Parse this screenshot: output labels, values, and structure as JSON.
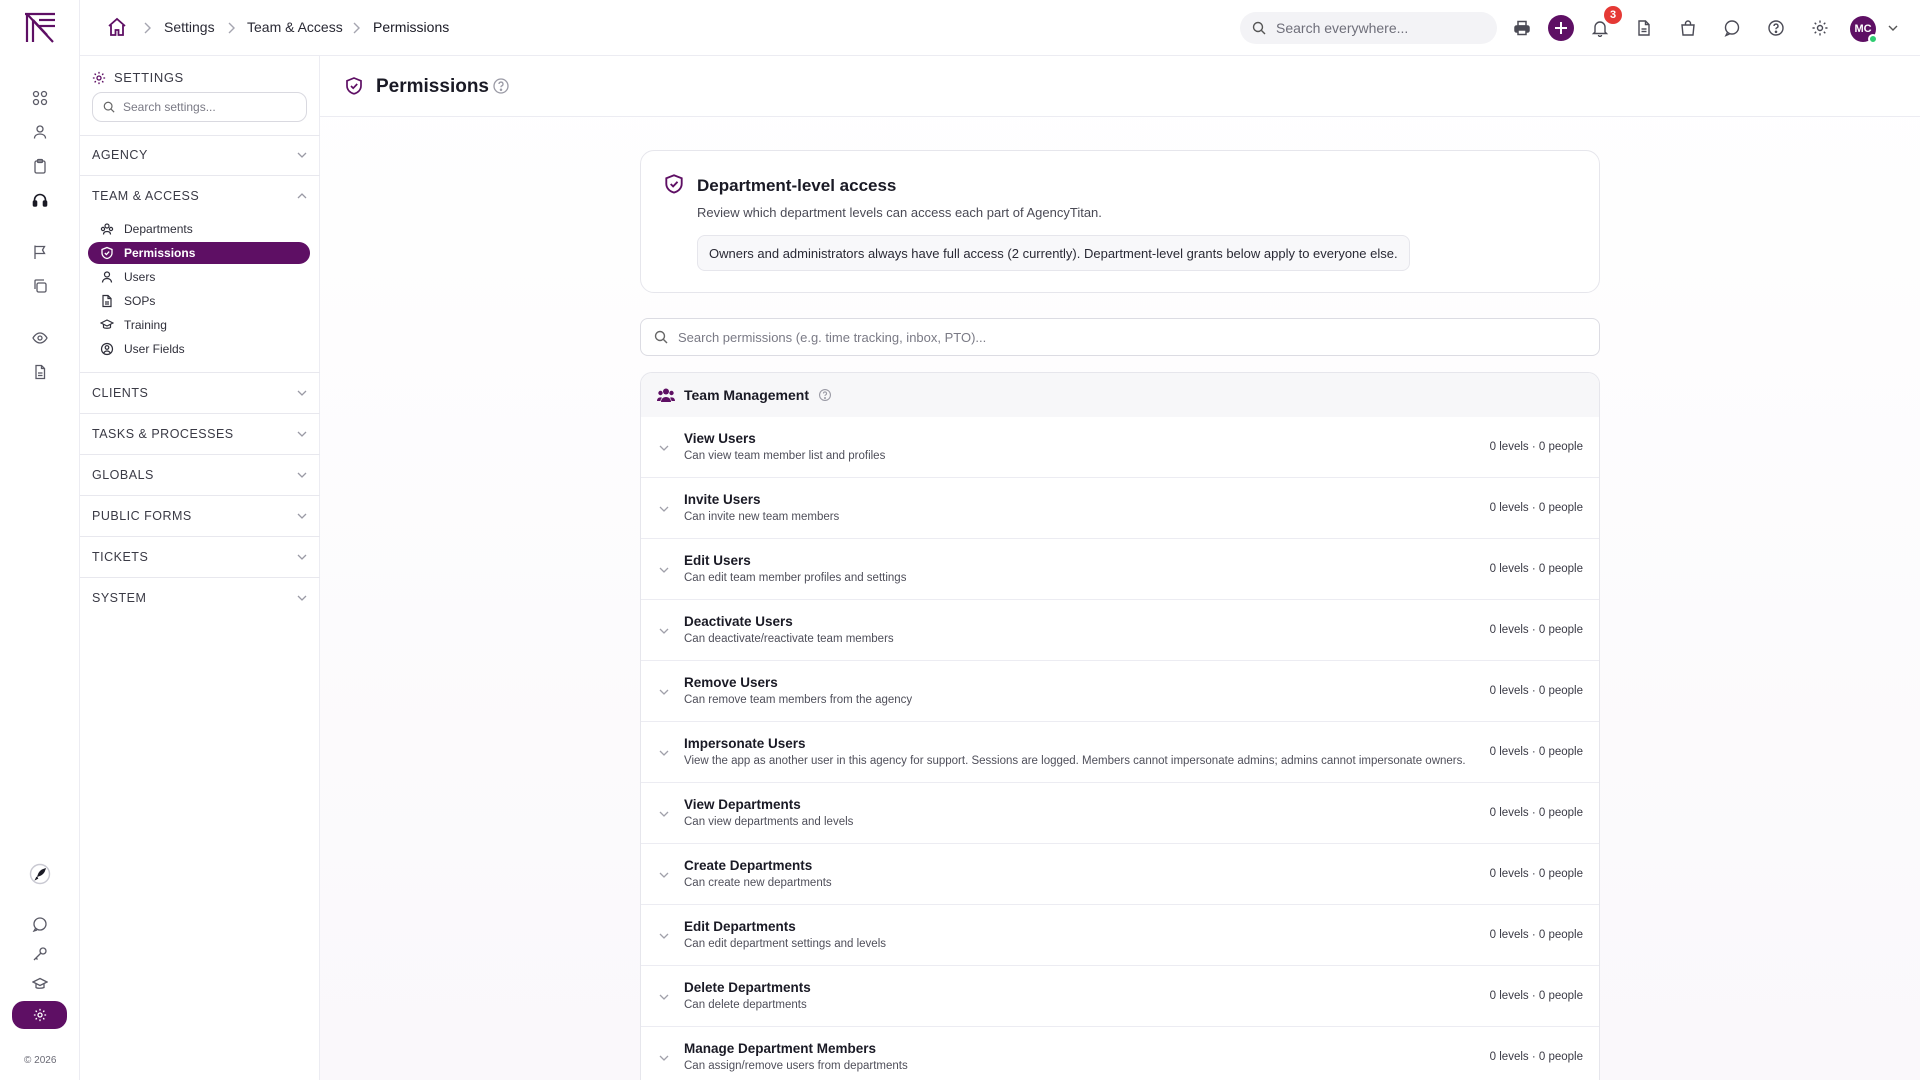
{
  "app": {
    "logo": "agencytitan-logo",
    "copyright": "© 2026"
  },
  "rail": {
    "icons": [
      "dashboard-icon",
      "user-icon",
      "clipboard-icon",
      "headset-icon",
      "flag-icon",
      "copy-icon",
      "eye-icon",
      "document-icon",
      "rocket-icon",
      "chat-icon",
      "key-icon",
      "graduation-icon",
      "gear-icon"
    ]
  },
  "breadcrumb": {
    "items": [
      "Settings",
      "Team & Access",
      "Permissions"
    ]
  },
  "topbar": {
    "search_placeholder": "Search everywhere...",
    "notifications_count": "3",
    "avatar_initials": "MC"
  },
  "settings_sidebar": {
    "title": "SETTINGS",
    "search_placeholder": "Search settings...",
    "sections": {
      "agency": "AGENCY",
      "team": "TEAM & ACCESS",
      "clients": "CLIENTS",
      "tasks": "TASKS & PROCESSES",
      "globals": "GLOBALS",
      "public_forms": "PUBLIC FORMS",
      "tickets": "TICKETS",
      "system": "SYSTEM"
    },
    "team_items": [
      "Departments",
      "Permissions",
      "Users",
      "SOPs",
      "Training",
      "User Fields"
    ],
    "active_item": "Permissions"
  },
  "page": {
    "title": "Permissions"
  },
  "info_card": {
    "title": "Department-level access",
    "subtitle": "Review which department levels can access each part of AgencyTitan.",
    "note": "Owners and administrators always have full access (2 currently). Department-level grants below apply to everyone else."
  },
  "permission_search": {
    "placeholder": "Search permissions (e.g. time tracking, inbox, PTO)..."
  },
  "group": {
    "title": "Team Management",
    "permissions": [
      {
        "name": "View Users",
        "desc": "Can view team member list and profiles",
        "meta": "0 levels · 0 people"
      },
      {
        "name": "Invite Users",
        "desc": "Can invite new team members",
        "meta": "0 levels · 0 people"
      },
      {
        "name": "Edit Users",
        "desc": "Can edit team member profiles and settings",
        "meta": "0 levels · 0 people"
      },
      {
        "name": "Deactivate Users",
        "desc": "Can deactivate/reactivate team members",
        "meta": "0 levels · 0 people"
      },
      {
        "name": "Remove Users",
        "desc": "Can remove team members from the agency",
        "meta": "0 levels · 0 people"
      },
      {
        "name": "Impersonate Users",
        "desc": "View the app as another user in this agency for support. Sessions are logged. Members cannot impersonate admins; admins cannot impersonate owners.",
        "meta": "0 levels · 0 people"
      },
      {
        "name": "View Departments",
        "desc": "Can view departments and levels",
        "meta": "0 levels · 0 people"
      },
      {
        "name": "Create Departments",
        "desc": "Can create new departments",
        "meta": "0 levels · 0 people"
      },
      {
        "name": "Edit Departments",
        "desc": "Can edit department settings and levels",
        "meta": "0 levels · 0 people"
      },
      {
        "name": "Delete Departments",
        "desc": "Can delete departments",
        "meta": "0 levels · 0 people"
      },
      {
        "name": "Manage Department Members",
        "desc": "Can assign/remove users from departments",
        "meta": "0 levels · 0 people"
      }
    ]
  },
  "colors": {
    "brand": "#5e0f64",
    "badge": "#e53935",
    "online": "#2ecc71"
  }
}
